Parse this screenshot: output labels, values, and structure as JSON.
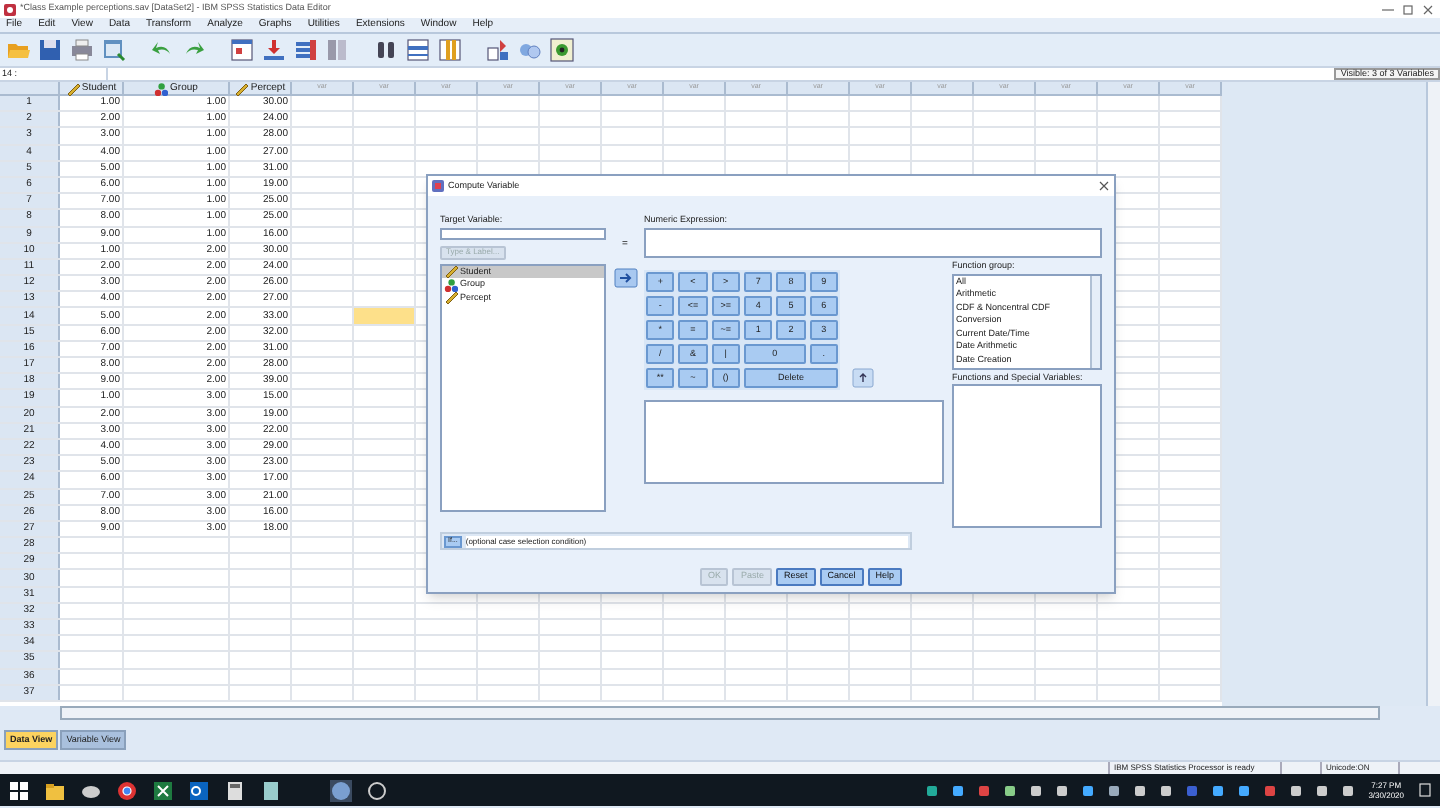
{
  "window": {
    "title": "*Class Example perceptions.sav [DataSet2] - IBM SPSS Statistics Data Editor"
  },
  "menu": [
    "File",
    "Edit",
    "View",
    "Data",
    "Transform",
    "Analyze",
    "Graphs",
    "Utilities",
    "Extensions",
    "Window",
    "Help"
  ],
  "cell_editor": {
    "cell": "14 :",
    "visible": "Visible: 3 of 3 Variables"
  },
  "columns": [
    {
      "label": "Student",
      "kind": "scale"
    },
    {
      "label": "Group",
      "kind": "nominal"
    },
    {
      "label": "Percept",
      "kind": "scale"
    }
  ],
  "var_columns": [
    "var",
    "var",
    "var",
    "var",
    "var",
    "var",
    "var",
    "var",
    "var",
    "var",
    "var",
    "var",
    "var",
    "var",
    "var"
  ],
  "rows": [
    {
      "number": "1",
      "cells": [
        "1.00",
        "1.00",
        "30.00"
      ],
      "highlighted": false
    },
    {
      "number": "2",
      "cells": [
        "2.00",
        "1.00",
        "24.00"
      ],
      "highlighted": false
    },
    {
      "number": "3",
      "cells": [
        "3.00",
        "1.00",
        "28.00"
      ],
      "highlighted": false
    },
    {
      "number": "4",
      "cells": [
        "4.00",
        "1.00",
        "27.00"
      ],
      "highlighted": false
    },
    {
      "number": "5",
      "cells": [
        "5.00",
        "1.00",
        "31.00"
      ],
      "highlighted": false
    },
    {
      "number": "6",
      "cells": [
        "6.00",
        "1.00",
        "19.00"
      ],
      "highlighted": false
    },
    {
      "number": "7",
      "cells": [
        "7.00",
        "1.00",
        "25.00"
      ],
      "highlighted": false
    },
    {
      "number": "8",
      "cells": [
        "8.00",
        "1.00",
        "25.00"
      ],
      "highlighted": false
    },
    {
      "number": "9",
      "cells": [
        "9.00",
        "1.00",
        "16.00"
      ],
      "highlighted": false
    },
    {
      "number": "10",
      "cells": [
        "1.00",
        "2.00",
        "30.00"
      ],
      "highlighted": false
    },
    {
      "number": "11",
      "cells": [
        "2.00",
        "2.00",
        "24.00"
      ],
      "highlighted": false
    },
    {
      "number": "12",
      "cells": [
        "3.00",
        "2.00",
        "26.00"
      ],
      "highlighted": false
    },
    {
      "number": "13",
      "cells": [
        "4.00",
        "2.00",
        "27.00"
      ],
      "highlighted": false
    },
    {
      "number": "14",
      "cells": [
        "5.00",
        "2.00",
        "33.00"
      ],
      "highlighted": true
    },
    {
      "number": "15",
      "cells": [
        "6.00",
        "2.00",
        "32.00"
      ],
      "highlighted": false
    },
    {
      "number": "16",
      "cells": [
        "7.00",
        "2.00",
        "31.00"
      ],
      "highlighted": false
    },
    {
      "number": "17",
      "cells": [
        "8.00",
        "2.00",
        "28.00"
      ],
      "highlighted": false
    },
    {
      "number": "18",
      "cells": [
        "9.00",
        "2.00",
        "39.00"
      ],
      "highlighted": false
    },
    {
      "number": "19",
      "cells": [
        "1.00",
        "3.00",
        "15.00"
      ],
      "highlighted": false
    },
    {
      "number": "20",
      "cells": [
        "2.00",
        "3.00",
        "19.00"
      ],
      "highlighted": false
    },
    {
      "number": "21",
      "cells": [
        "3.00",
        "3.00",
        "22.00"
      ],
      "highlighted": false
    },
    {
      "number": "22",
      "cells": [
        "4.00",
        "3.00",
        "29.00"
      ],
      "highlighted": false
    },
    {
      "number": "23",
      "cells": [
        "5.00",
        "3.00",
        "23.00"
      ],
      "highlighted": false
    },
    {
      "number": "24",
      "cells": [
        "6.00",
        "3.00",
        "17.00"
      ],
      "highlighted": false
    },
    {
      "number": "25",
      "cells": [
        "7.00",
        "3.00",
        "21.00"
      ],
      "highlighted": false
    },
    {
      "number": "26",
      "cells": [
        "8.00",
        "3.00",
        "16.00"
      ],
      "highlighted": false
    },
    {
      "number": "27",
      "cells": [
        "9.00",
        "3.00",
        "18.00"
      ],
      "highlighted": false
    },
    {
      "number": "28",
      "cells": [],
      "highlighted": false
    },
    {
      "number": "29",
      "cells": [],
      "highlighted": false
    },
    {
      "number": "30",
      "cells": [],
      "highlighted": false
    },
    {
      "number": "31",
      "cells": [],
      "highlighted": false
    },
    {
      "number": "32",
      "cells": [],
      "highlighted": false
    },
    {
      "number": "33",
      "cells": [],
      "highlighted": false
    },
    {
      "number": "34",
      "cells": [],
      "highlighted": false
    },
    {
      "number": "35",
      "cells": [],
      "highlighted": false
    },
    {
      "number": "36",
      "cells": [],
      "highlighted": false
    },
    {
      "number": "37",
      "cells": [],
      "highlighted": false
    }
  ],
  "view_tabs": [
    {
      "label": "Data View",
      "selected": true
    },
    {
      "label": "Variable View",
      "selected": false
    }
  ],
  "status_bar": {
    "processor": "IBM SPSS Statistics Processor is ready",
    "unicode": "Unicode:ON"
  },
  "dialog": {
    "title": "Compute Variable",
    "target_label": "Target Variable:",
    "type_label_button": {
      "label": "Type & Label...",
      "disabled": true
    },
    "equals": "=",
    "expression_label": "Numeric Expression:",
    "variables": [
      {
        "name": "Student",
        "kind": "scale",
        "selected": true
      },
      {
        "name": "Group",
        "kind": "nominal",
        "selected": false
      },
      {
        "name": "Percept",
        "kind": "scale",
        "selected": false
      }
    ],
    "keypad": [
      {
        "label": "+",
        "kind": "key"
      },
      {
        "label": "<",
        "kind": "key"
      },
      {
        "label": ">",
        "kind": "key"
      },
      {
        "label": "7",
        "kind": "key"
      },
      {
        "label": "8",
        "kind": "key"
      },
      {
        "label": "9",
        "kind": "key"
      },
      {
        "label": "-",
        "kind": "key"
      },
      {
        "label": "<=",
        "kind": "key"
      },
      {
        "label": ">=",
        "kind": "key"
      },
      {
        "label": "4",
        "kind": "key"
      },
      {
        "label": "5",
        "kind": "key"
      },
      {
        "label": "6",
        "kind": "key"
      },
      {
        "label": "*",
        "kind": "key"
      },
      {
        "label": "=",
        "kind": "key"
      },
      {
        "label": "~=",
        "kind": "key"
      },
      {
        "label": "1",
        "kind": "key"
      },
      {
        "label": "2",
        "kind": "key"
      },
      {
        "label": "3",
        "kind": "key"
      },
      {
        "label": "/",
        "kind": "key"
      },
      {
        "label": "&",
        "kind": "key"
      },
      {
        "label": "|",
        "kind": "key"
      },
      {
        "label": "0",
        "kind": "double"
      },
      {
        "label": ".",
        "kind": "key"
      },
      {
        "label": "**",
        "kind": "key"
      },
      {
        "label": "~",
        "kind": "key"
      },
      {
        "label": "()",
        "kind": "key"
      },
      {
        "label": "Delete",
        "kind": "triple"
      }
    ],
    "function_group_label": "Function group:",
    "function_groups": [
      "All",
      "Arithmetic",
      "CDF & Noncentral CDF",
      "Conversion",
      "Current Date/Time",
      "Date Arithmetic",
      "Date Creation"
    ],
    "functions_label": "Functions and Special Variables:",
    "if_button": "If...",
    "if_condition": "(optional case selection condition)",
    "buttons": [
      {
        "label": "OK",
        "disabled": true
      },
      {
        "label": "Paste",
        "disabled": true
      },
      {
        "label": "Reset",
        "disabled": false
      },
      {
        "label": "Cancel",
        "disabled": false
      },
      {
        "label": "Help",
        "disabled": false
      }
    ]
  },
  "taskbar": {
    "time": "7:27 PM",
    "date": "3/30/2020"
  }
}
